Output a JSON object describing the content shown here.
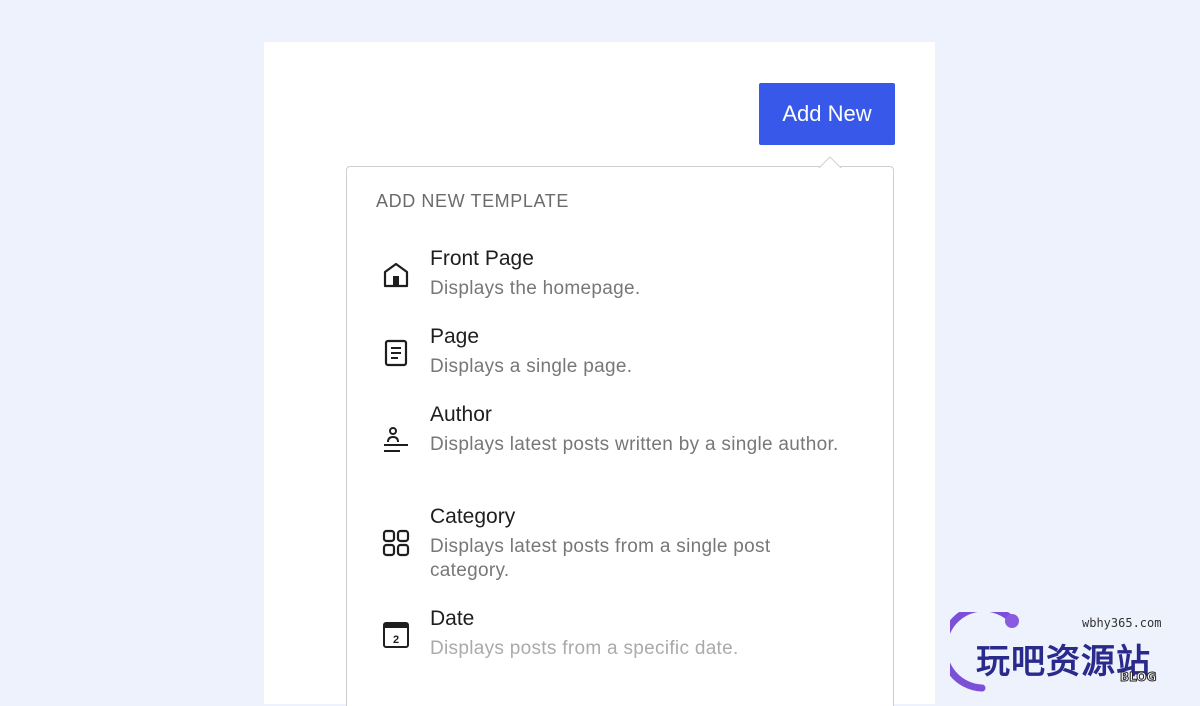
{
  "toolbar": {
    "add_new_label": "Add New"
  },
  "popover": {
    "heading": "ADD NEW TEMPLATE",
    "items": [
      {
        "title": "Front Page",
        "description": "Displays the homepage.",
        "icon": "home-icon"
      },
      {
        "title": "Page",
        "description": "Displays a single page.",
        "icon": "page-icon"
      },
      {
        "title": "Author",
        "description": "Displays latest posts written by a single author.",
        "icon": "author-icon"
      },
      {
        "title": "Category",
        "description": "Displays latest posts from a single post category.",
        "icon": "category-icon"
      },
      {
        "title": "Date",
        "description": "Displays posts from a specific date.",
        "icon": "calendar-icon",
        "icon_text": "2"
      }
    ]
  },
  "watermark": {
    "url": "wbhy365.com",
    "name": "玩吧资源站",
    "badge": "BLOG"
  },
  "colors": {
    "page_background": "#eef2fd",
    "accent": "#3858e9",
    "title_text": "#1e1e1e",
    "description_text": "#777777"
  }
}
